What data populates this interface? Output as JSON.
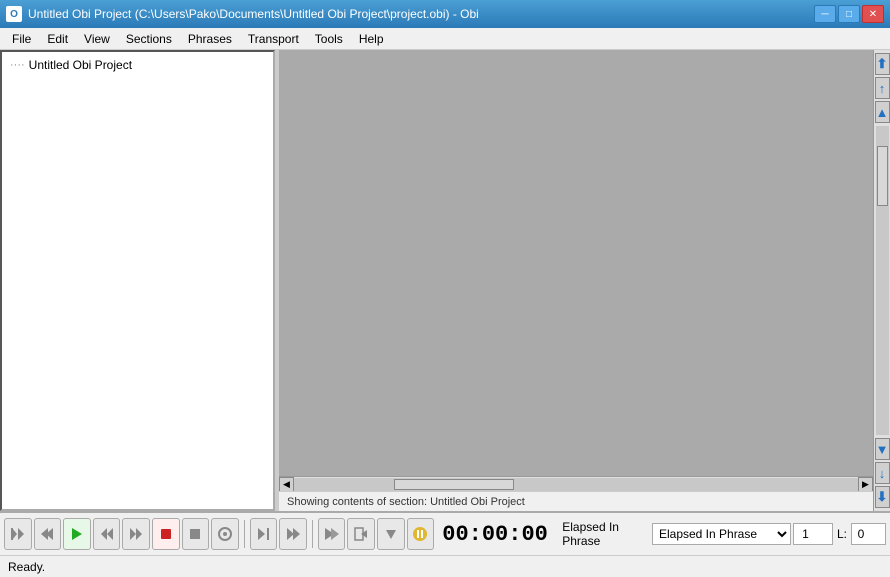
{
  "window": {
    "title": "Untitled Obi Project (C:\\Users\\Pako\\Documents\\Untitled Obi Project\\project.obi) - Obi"
  },
  "titlebar": {
    "minimize": "─",
    "maximize": "□",
    "close": "✕"
  },
  "menubar": {
    "items": [
      "File",
      "Edit",
      "View",
      "Sections",
      "Phrases",
      "Transport",
      "Tools",
      "Help"
    ]
  },
  "sections_panel": {
    "tree_item": "Untitled Obi Project",
    "tree_dots": "····"
  },
  "status_section": {
    "text": "Showing contents of section:  Untitled Obi Project"
  },
  "toolbar": {
    "time": "00:00:00",
    "elapsed_label": "Elapsed In Phrase",
    "spinner_value": "1",
    "l_label": "L:",
    "l_value": "0"
  },
  "statusbar": {
    "text": "Ready."
  },
  "scrollbar": {
    "top_double_arrow": "⇈",
    "top_arrow": "↑",
    "up_triangle": "▲",
    "down_triangle": "▼",
    "down_arrow": "↓",
    "bottom_double": "⇊"
  }
}
